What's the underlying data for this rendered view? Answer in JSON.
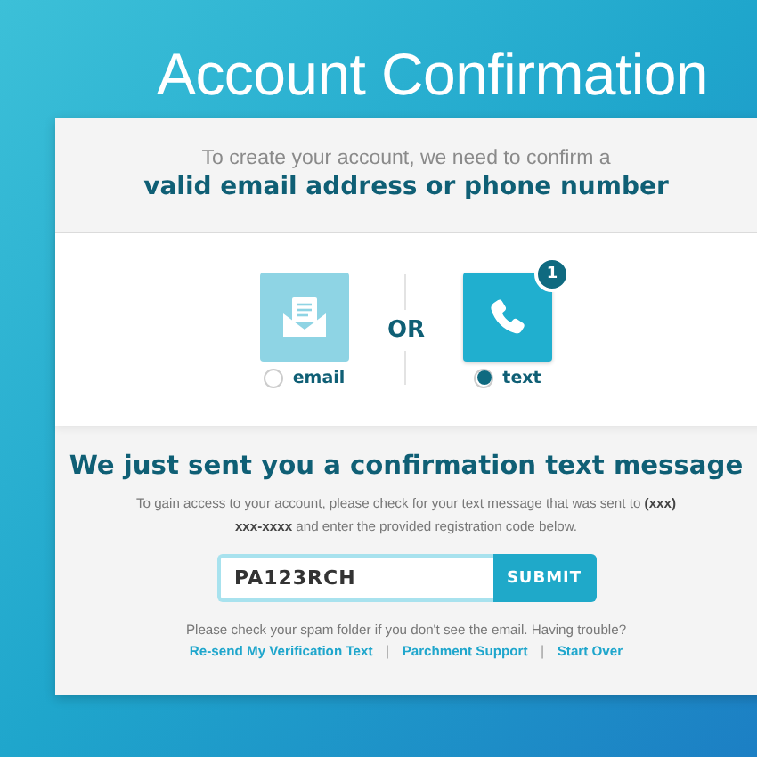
{
  "title": "Account Confirmation",
  "intro": {
    "line1": "To create your account, we need to confirm a",
    "line2": "valid email address or phone number"
  },
  "options": [
    {
      "kind": "email",
      "label": "email",
      "selected": false
    },
    {
      "kind": "phone",
      "label": "text",
      "selected": true,
      "badge": "1"
    }
  ],
  "separator": "OR",
  "message": {
    "heading": "We just sent you a confirmation text message",
    "body": "To gain access to your account, please check for your text message that was sent to **(xxx) xxx-xxxx** and enter the provided registration code below."
  },
  "code_field": {
    "value": "PA123RCH"
  },
  "submit": "SUBMIT",
  "note": "Please check your spam folder if you don't see the email. Having trouble?",
  "links": [
    {
      "label": "Re-send My Verification Text"
    },
    {
      "label": "Parchment Support"
    },
    {
      "label": "Start Over"
    }
  ],
  "link_separators": [
    "|",
    "|"
  ]
}
